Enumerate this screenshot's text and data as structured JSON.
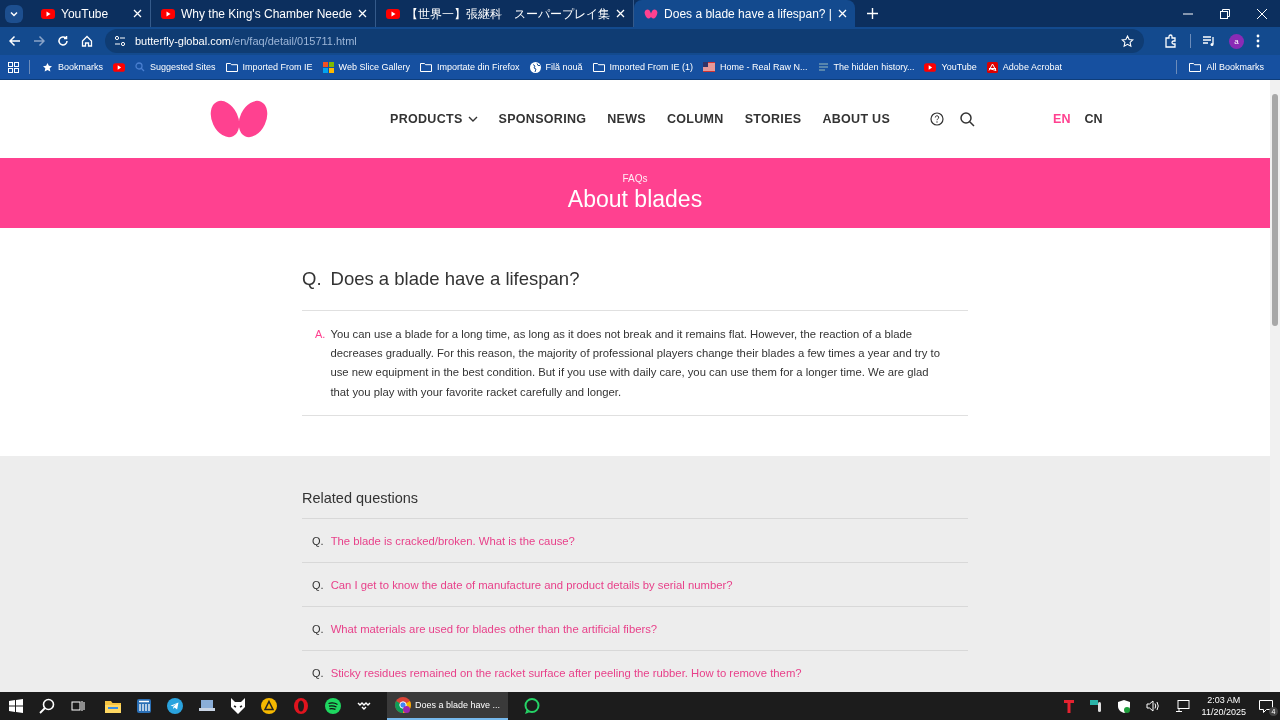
{
  "browser": {
    "tabs": [
      {
        "title": "YouTube",
        "kind": "youtube",
        "selected": false
      },
      {
        "title": "Why the King's Chamber Neede",
        "kind": "youtube",
        "selected": false
      },
      {
        "title": "【世界一】張継科　スーパープレイ集",
        "kind": "youtube",
        "selected": false
      },
      {
        "title": "Does a blade have a lifespan? |",
        "kind": "butterfly",
        "selected": true
      }
    ],
    "address": {
      "domain": "butterfly-global.com",
      "path": "/en/faq/detail/015711.html"
    },
    "bookmarks": [
      {
        "kind": "star",
        "label": "Bookmarks"
      },
      {
        "kind": "youtube"
      },
      {
        "kind": "search",
        "label": "Suggested Sites"
      },
      {
        "kind": "folder",
        "label": "Imported From IE"
      },
      {
        "kind": "windows",
        "label": "Web Slice Gallery"
      },
      {
        "kind": "folder",
        "label": "Importate din Firefox"
      },
      {
        "kind": "globe",
        "label": "Filă nouă"
      },
      {
        "kind": "folder",
        "label": "Imported From IE (1)"
      },
      {
        "kind": "flag",
        "label": "Home - Real Raw N..."
      },
      {
        "kind": "page",
        "label": "The hidden history..."
      },
      {
        "kind": "youtube",
        "label": "YouTube"
      },
      {
        "kind": "acrobat",
        "label": "Adobe Acrobat"
      }
    ],
    "all_bookmarks": "All Bookmarks",
    "profile": "a"
  },
  "site": {
    "nav": [
      {
        "label": "PRODUCTS",
        "dropdown": true
      },
      {
        "label": "SPONSORING",
        "dropdown": false
      },
      {
        "label": "NEWS",
        "dropdown": false
      },
      {
        "label": "COLUMN",
        "dropdown": false
      },
      {
        "label": "STORIES",
        "dropdown": false
      },
      {
        "label": "ABOUT US",
        "dropdown": false
      }
    ],
    "languages": [
      {
        "label": "EN",
        "selected": true
      },
      {
        "label": "CN",
        "selected": false
      }
    ]
  },
  "banner": {
    "eyebrow": "FAQs",
    "title": "About blades"
  },
  "question": {
    "marker": "Q.",
    "text": "Does a blade have a lifespan?"
  },
  "answer": {
    "marker": "A.",
    "text": "You can use a blade for a long time, as long as it does not break and it remains flat. However, the reaction of a blade decreases gradually. For this reason, the majority of professional players change their blades a few times a year and try to use new equipment in the best condition. But if you use with daily care, you can use them for a longer time. We are glad that you play with your favorite racket carefully and longer."
  },
  "related": {
    "title": "Related questions",
    "items": [
      {
        "marker": "Q.",
        "text": "The blade is cracked/broken. What is the cause?"
      },
      {
        "marker": "Q.",
        "text": "Can I get to know the date of manufacture and product details by serial number?"
      },
      {
        "marker": "Q.",
        "text": "What materials are used for blades other than the artificial fibers?"
      },
      {
        "marker": "Q.",
        "text": "Sticky residues remained on the racket surface after peeling the rubber. How to remove them?"
      }
    ]
  },
  "taskbar": {
    "active_window": "Does a blade have ...",
    "time": "2:03 AM",
    "date": "11/20/2025",
    "notifications": "4"
  }
}
